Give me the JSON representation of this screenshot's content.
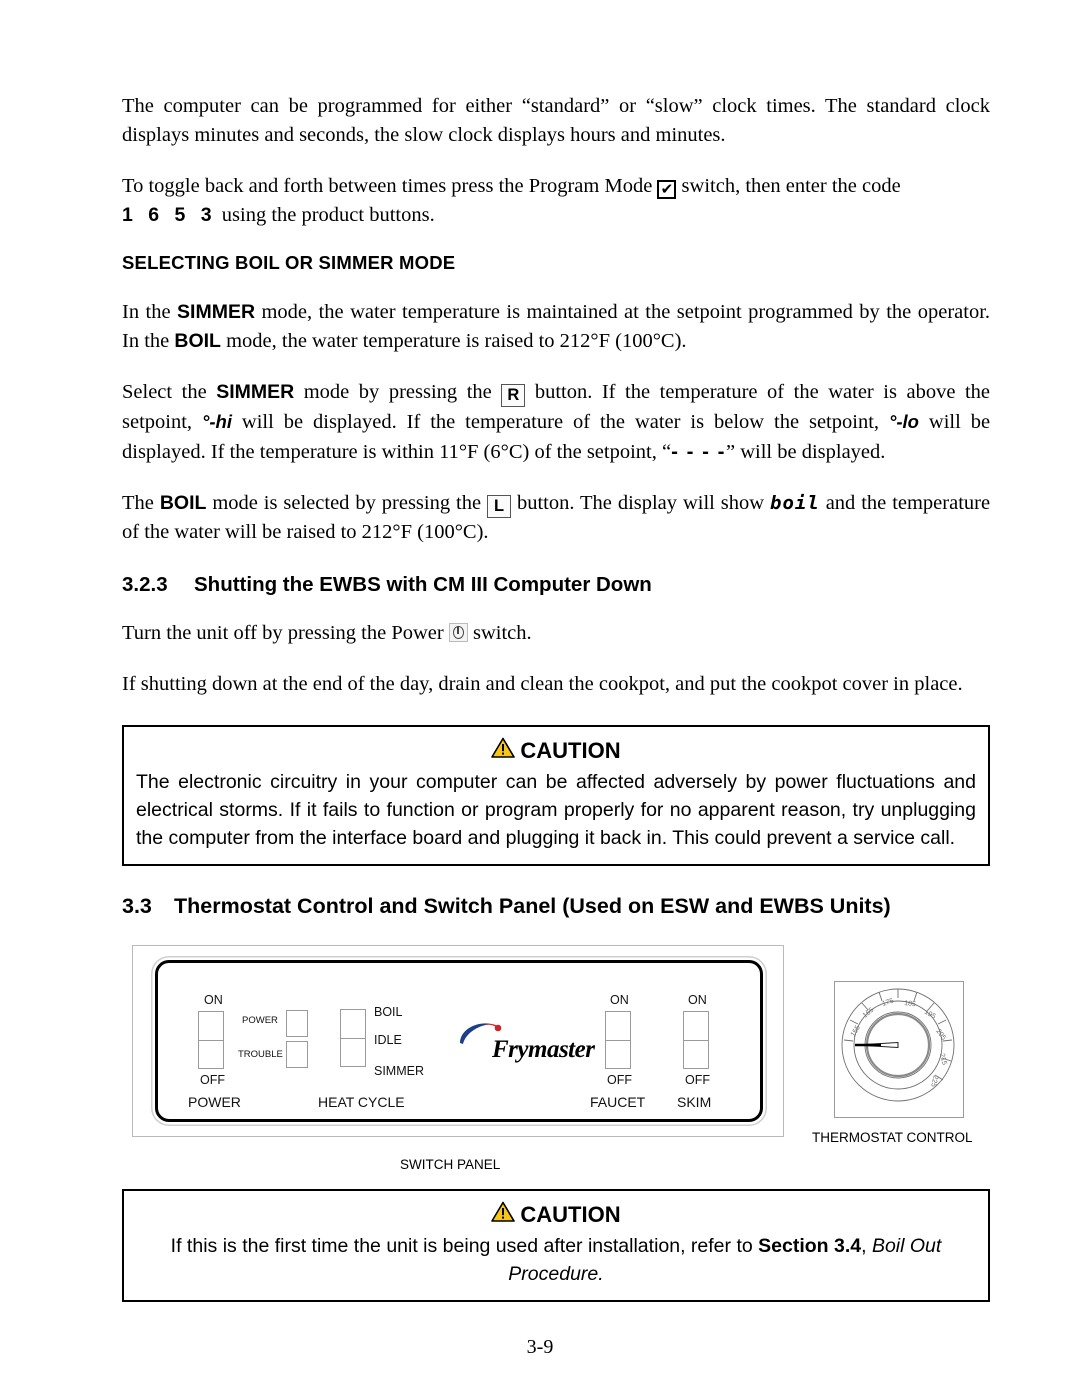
{
  "document": {
    "page_number": "3-9"
  },
  "paragraphs": {
    "p1": "The computer can be programmed for either “standard” or “slow” clock times. The standard clock displays minutes and seconds, the slow clock displays hours and minutes.",
    "p2_a": "To toggle back and forth between times press the Program Mode",
    "p2_b": "switch, then enter the code",
    "p2_code": "1 6 5 3",
    "p2_c": "using the product buttons.",
    "heading_caps": "SELECTING BOIL OR SIMMER MODE",
    "p3_a": "In the",
    "p3_simmer": "SIMMER",
    "p3_b": "mode, the water temperature is maintained at the setpoint programmed by the operator.  In the",
    "p3_boil": "BOIL",
    "p3_c": "mode, the water temperature is raised to 212°F (100°C).",
    "p4_a": "Select the",
    "p4_simmer": "SIMMER",
    "p4_b": "mode by pressing the",
    "p4_key": "R",
    "p4_c": "button.  If the temperature of the water is above the setpoint,",
    "p4_hi": "°-hi",
    "p4_d": "will be displayed.  If the temperature of the water is below the setpoint,",
    "p4_lo": "°-lo",
    "p4_e": "will be displayed.  If the temperature is within 11°F (6°C) of the setpoint, “",
    "p4_dashes": "- - - -",
    "p4_f": "” will be displayed.",
    "p5_a": "The",
    "p5_boil": "BOIL",
    "p5_b": "mode is selected by pressing the",
    "p5_key": "L",
    "p5_c": "button.   The display will show",
    "p5_display": "boil",
    "p5_d": "and the temperature of the water will be raised to 212°F (100°C).",
    "p6_a": "Turn the unit off by pressing the Power",
    "p6_b": "switch.",
    "p7": "If shutting down at the end of the day, drain and clean the cookpot, and put the cookpot cover in place."
  },
  "sections": {
    "s323_num": "3.2.3",
    "s323_title": "Shutting the EWBS with CM III Computer Down",
    "s33_num": "3.3",
    "s33_title": "Thermostat Control and Switch Panel (Used on ESW and EWBS Units)"
  },
  "caution_1": {
    "title": "CAUTION",
    "body": "The electronic circuitry in your computer can be affected adversely by power fluctuations and electrical storms. If it fails to function or program properly for no apparent reason, try unplugging the computer from the interface board and plugging it back in.   This could prevent a service call."
  },
  "caution_2": {
    "title": "CAUTION",
    "line1_a": "If this is the first time the unit is being used after installation, refer to",
    "line1_bold": "Section 3.4",
    "line1_comma": ",",
    "line1_italic": "Boil Out Procedure."
  },
  "figure": {
    "panel_caption": "SWITCH PANEL",
    "thermostat_caption": "THERMOSTAT CONTROL",
    "logo_text": "Frymaster",
    "logo_tm": "®",
    "switches": {
      "power_on": "ON",
      "power_off": "OFF",
      "power_name": "POWER",
      "lamp_power": "POWER",
      "lamp_trouble": "TROUBLE",
      "heat_boil": "BOIL",
      "heat_idle": "IDLE",
      "heat_simmer": "SIMMER",
      "heat_name": "HEAT  CYCLE",
      "faucet_on": "ON",
      "faucet_off": "OFF",
      "faucet_name": "FAUCET",
      "skim_on": "ON",
      "skim_off": "OFF",
      "skim_name": "SKIM"
    },
    "dial_ticks": [
      "155",
      "165",
      "175",
      "185",
      "195",
      "205",
      "215",
      "225"
    ]
  },
  "colors": {
    "caution_triangle_fill": "#f5c518",
    "caution_triangle_stroke": "#000000",
    "logo_swoosh_blue": "#1b3f8b",
    "logo_swoosh_red": "#d0222b",
    "panel_border": "#000000"
  }
}
